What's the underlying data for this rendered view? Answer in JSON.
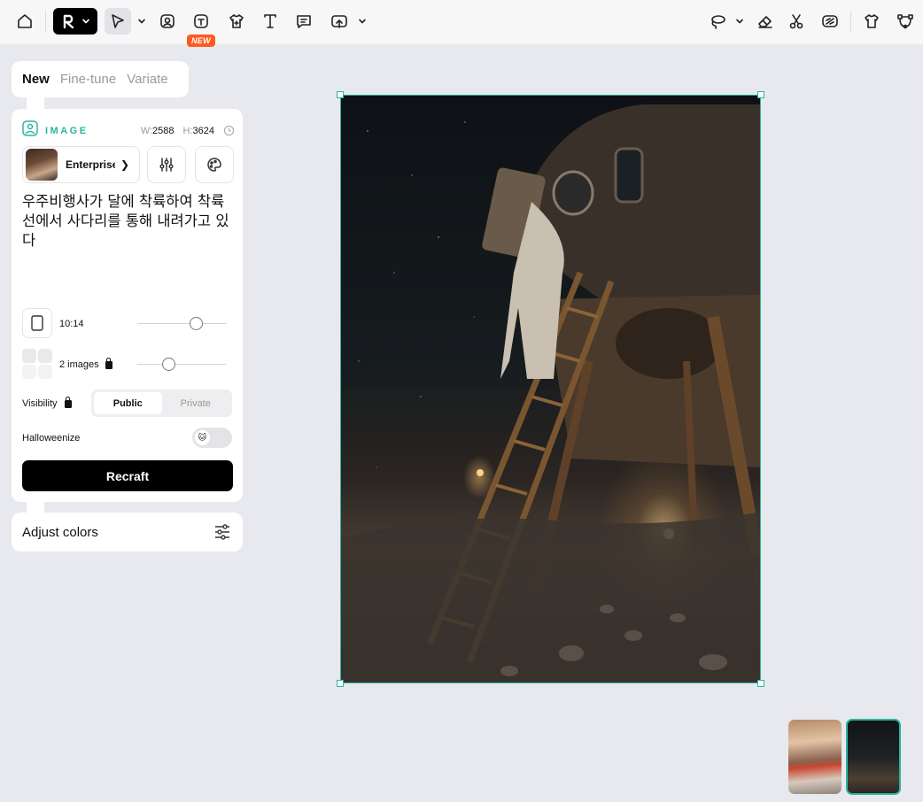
{
  "toolbar": {
    "new_badge": "NEW",
    "tools": [
      "home-icon",
      "logo-menu",
      "select-tool",
      "image-tool",
      "mockup-tool",
      "tshirt-tool",
      "text-tool",
      "comment-tool",
      "export-tool",
      "lasso-tool",
      "eraser-tool",
      "scissors-tool",
      "vectorize-tool",
      "shirt-tool",
      "nodes-tool"
    ]
  },
  "tabs": [
    {
      "label": "New",
      "active": true
    },
    {
      "label": "Fine-tune",
      "active": false
    },
    {
      "label": "Variate",
      "active": false
    }
  ],
  "panel": {
    "section_label": "IMAGE",
    "width_label": "W:",
    "width_value": "2588",
    "height_label": "H:",
    "height_value": "3624",
    "model_name": "Enterprise",
    "prompt": "우주비행사가 달에 착륙하여 착륙선에서 사다리를 통해 내려가고 있다",
    "aspect_ratio": "10:14",
    "image_count": "2 images",
    "visibility_label": "Visibility",
    "visibility_options": [
      "Public",
      "Private"
    ],
    "visibility_selected": "Public",
    "halloweenize_label": "Halloweenize",
    "halloweenize_on": false,
    "recraft_button": "Recraft",
    "aspect_slider": 0.65,
    "count_slider": 0.35
  },
  "adjust_colors": {
    "label": "Adjust colors"
  },
  "colors": {
    "accent": "#2bb5a0",
    "badge": "#ff5a1f",
    "primary_button": "#000000",
    "canvas_bg": "#e8e9ee"
  }
}
